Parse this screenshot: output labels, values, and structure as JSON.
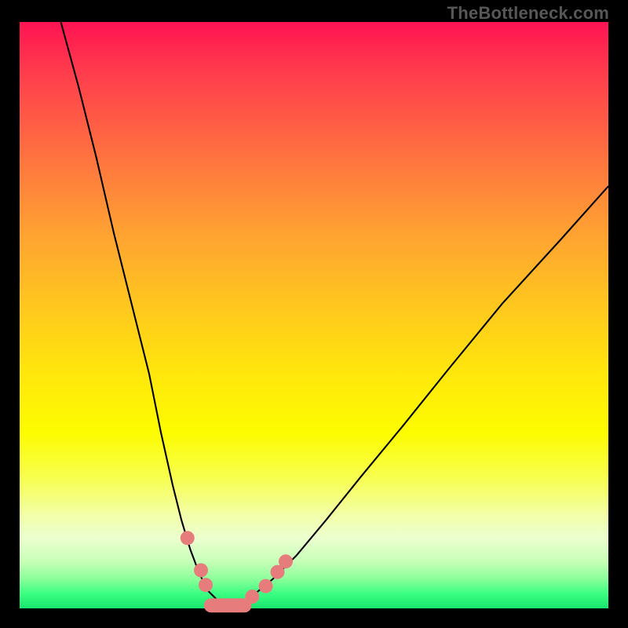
{
  "attribution": "TheBottleneck.com",
  "chart_data": {
    "type": "line",
    "title": "",
    "xlabel": "",
    "ylabel": "",
    "xlim": [
      0,
      100
    ],
    "ylim": [
      0,
      100
    ],
    "series": [
      {
        "name": "left-branch",
        "x": [
          7,
          10,
          13,
          16,
          19,
          22,
          24,
          26,
          27.5,
          29,
          30.5,
          32,
          34,
          36
        ],
        "values": [
          100,
          89,
          77,
          64,
          52,
          40,
          30,
          21,
          15,
          10,
          6,
          3,
          1,
          0
        ]
      },
      {
        "name": "right-branch",
        "x": [
          36,
          38,
          40,
          43,
          47,
          52,
          58,
          65,
          73,
          82,
          92,
          100
        ],
        "values": [
          0,
          1,
          2.5,
          5,
          9,
          15,
          22.5,
          31,
          41,
          52,
          63,
          72
        ]
      }
    ],
    "markers": [
      {
        "x": 28.5,
        "y": 12
      },
      {
        "x": 30.8,
        "y": 6.5
      },
      {
        "x": 31.6,
        "y": 4
      },
      {
        "x": 39.5,
        "y": 2
      },
      {
        "x": 41.8,
        "y": 3.8
      },
      {
        "x": 43.8,
        "y": 6.2
      },
      {
        "x": 45.2,
        "y": 8
      }
    ],
    "floor_segment": {
      "x0": 32.5,
      "x1": 38.2,
      "y": 0.5
    },
    "gradient_stops": [
      {
        "pos": 0,
        "color": "#ff1352"
      },
      {
        "pos": 50,
        "color": "#ffd400"
      },
      {
        "pos": 100,
        "color": "#17e56e"
      }
    ]
  }
}
